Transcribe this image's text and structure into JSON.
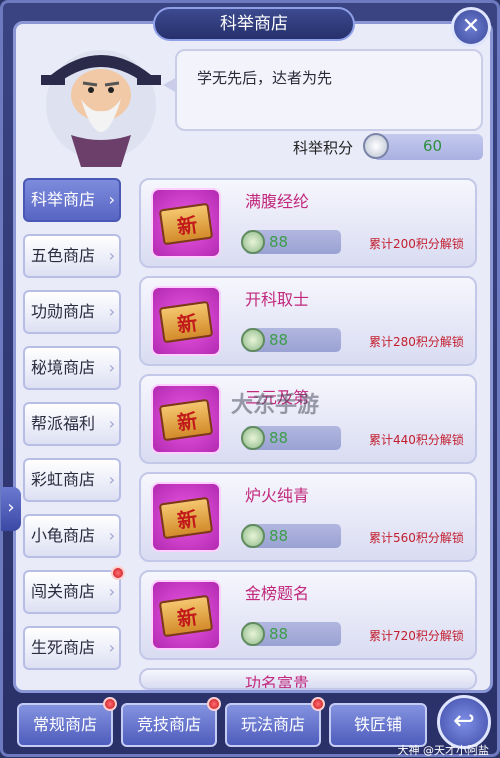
{
  "window": {
    "title": "科举商店"
  },
  "npc": {
    "speech": "学无先后，达者为先"
  },
  "points": {
    "label": "科举积分",
    "value": "60"
  },
  "side_tabs": [
    {
      "label": "科举商店",
      "active": true
    },
    {
      "label": "五色商店"
    },
    {
      "label": "功勋商店"
    },
    {
      "label": "秘境商店"
    },
    {
      "label": "帮派福利"
    },
    {
      "label": "彩虹商店"
    },
    {
      "label": "小龟商店"
    },
    {
      "label": "闯关商店",
      "badge": true
    },
    {
      "label": "生死商店"
    }
  ],
  "items": [
    {
      "name": "满腹经纶",
      "price": "88",
      "unlock": "累计200积分解锁",
      "icon_glyph": "新"
    },
    {
      "name": "开科取士",
      "price": "88",
      "unlock": "累计280积分解锁",
      "icon_glyph": "新"
    },
    {
      "name": "三元及第",
      "price": "88",
      "unlock": "累计440积分解锁",
      "icon_glyph": "新"
    },
    {
      "name": "炉火纯青",
      "price": "88",
      "unlock": "累计560积分解锁",
      "icon_glyph": "新"
    },
    {
      "name": "金榜题名",
      "price": "88",
      "unlock": "累计720积分解锁",
      "icon_glyph": "新"
    },
    {
      "name": "功名富贵",
      "price": "",
      "unlock": "",
      "icon_glyph": "新"
    }
  ],
  "bottom_tabs": [
    {
      "label": "常规商店",
      "badge": true
    },
    {
      "label": "竞技商店",
      "badge": true
    },
    {
      "label": "玩法商店",
      "badge": true
    },
    {
      "label": "铁匠铺"
    }
  ],
  "watermark": "大东手游",
  "credit": "大神 @天才小阿盐",
  "icons": {
    "close": "close-icon",
    "back": "back-arrow-icon",
    "coin": "coin-icon",
    "points": "quill-icon"
  }
}
